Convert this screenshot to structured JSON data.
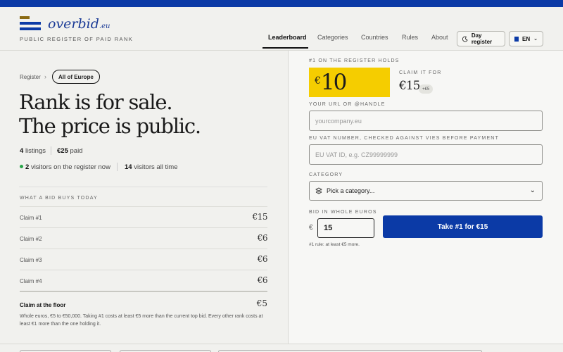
{
  "header": {
    "logo_name": "overbid",
    "logo_tld": ".eu",
    "tagline": "PUBLIC REGISTER OF PAID RANK",
    "nav": [
      {
        "label": "Leaderboard",
        "active": true
      },
      {
        "label": "Categories",
        "active": false
      },
      {
        "label": "Countries",
        "active": false
      },
      {
        "label": "Rules",
        "active": false
      },
      {
        "label": "About",
        "active": false
      }
    ],
    "day_register_label": "Day register",
    "day_register_icon": "moon-icon",
    "lang_label": "EN",
    "lang_icon": "eu-flag-icon"
  },
  "breadcrumb": {
    "root": "Register",
    "current": "All of Europe"
  },
  "hero": {
    "line1": "Rank is for sale.",
    "line2": "The price is public."
  },
  "stats": {
    "listings_count": "4",
    "listings_label": "listings",
    "paid_amount": "€25",
    "paid_label": "paid",
    "visitors_now": "2",
    "visitors_now_label": "visitors on the register now",
    "visitors_all": "14",
    "visitors_all_label": "visitors all time"
  },
  "bids": {
    "section_label": "WHAT A BID BUYS TODAY",
    "rows": [
      {
        "label": "Claim #1",
        "value": "€15"
      },
      {
        "label": "Claim #2",
        "value": "€6"
      },
      {
        "label": "Claim #3",
        "value": "€6"
      },
      {
        "label": "Claim #4",
        "value": "€6"
      }
    ],
    "floor_label": "Claim at the floor",
    "floor_value": "€5",
    "note": "Whole euros, €5 to €50,000. Taking #1 costs at least €5 more than the current top bid. Every other rank costs at least €1 more than the one holding it."
  },
  "claim": {
    "holds_label": "#1 ON THE REGISTER HOLDS",
    "holds_currency": "€",
    "holds_amount": "10",
    "claim_label": "CLAIM IT FOR",
    "claim_price": "€15",
    "claim_delta": "+€5",
    "url_label": "YOUR URL OR @HANDLE",
    "url_placeholder": "yourcompany.eu",
    "vat_label": "EU VAT NUMBER, CHECKED AGAINST VIES BEFORE PAYMENT",
    "vat_placeholder": "EU VAT ID, e.g. CZ99999999",
    "category_label": "CATEGORY",
    "category_value": "Pick a category...",
    "category_icon": "layers-icon",
    "bid_label": "BID IN WHOLE EUROS",
    "bid_currency": "€",
    "bid_value": "15",
    "cta_label": "Take #1 for €15",
    "rule_hint": "#1 rule: at least €5 more."
  },
  "colors": {
    "brand_blue": "#0b3aa6",
    "highlight_yellow": "#f5cd00",
    "online_green": "#2aa64a"
  }
}
